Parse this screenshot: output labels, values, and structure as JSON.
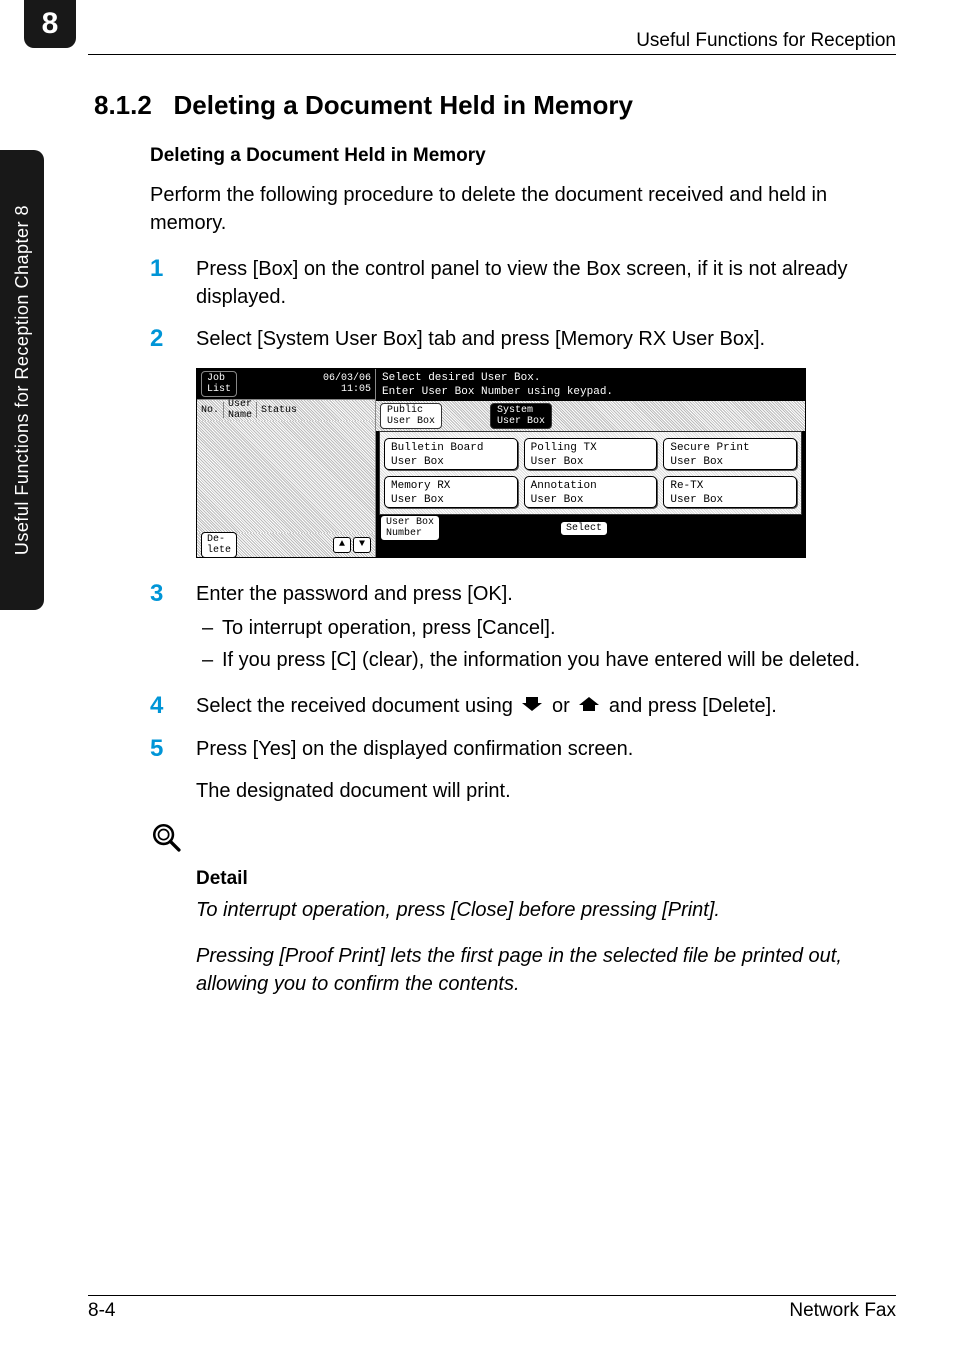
{
  "chapter": {
    "number": "8",
    "sideLabel": "Useful Functions for Reception     Chapter 8"
  },
  "headerRight": "Useful Functions for Reception",
  "section": {
    "number": "8.1.2",
    "title": "Deleting a Document Held in Memory"
  },
  "subheading": "Deleting a Document Held in Memory",
  "intro": "Perform the following procedure to delete the document received and held in memory.",
  "steps": {
    "s1": {
      "num": "1",
      "text": "Press [Box] on the control panel to view the Box screen, if it is not already displayed."
    },
    "s2": {
      "num": "2",
      "text": "Select [System User Box] tab and press [Memory RX User Box]."
    },
    "s3": {
      "num": "3",
      "text": "Enter the password and press [OK]."
    },
    "s3a": "To interrupt operation, press [Cancel].",
    "s3b": "If you press [C] (clear), the information you have entered will be deleted.",
    "s4": {
      "num": "4",
      "pre": "Select the received document using ",
      "mid": " or ",
      "post": " and press [Delete]."
    },
    "s5": {
      "num": "5",
      "text": "Press [Yes] on the displayed confirmation screen."
    }
  },
  "resultText": "The designated document will print.",
  "detail": {
    "heading": "Detail",
    "p1": "To interrupt operation, press [Close] before pressing [Print].",
    "p2": "Pressing [Proof Print] lets the first page in the selected file be printed out, allowing you to confirm the contents."
  },
  "screenshot": {
    "jobList": "Job\nList",
    "date": "06/03/06",
    "time": "11:05",
    "hdrNo": "No.",
    "hdrUser": "User\nName",
    "hdrStatus": "Status",
    "deleteBtn": "De-\nlete",
    "prompt1": "Select desired User Box.",
    "prompt2": "Enter User Box Number using keypad.",
    "tabPublic": "Public\nUser Box",
    "tabSystem": "System\nUser Box",
    "btnBulletin": "Bulletin Board\nUser Box",
    "btnPolling": "Polling TX\nUser Box",
    "btnSecure": "Secure Print\nUser Box",
    "btnMemory": "Memory RX\nUser Box",
    "btnAnnotation": "Annotation\nUser Box",
    "btnRetx": "Re-TX\nUser Box",
    "btnUserBoxNum": "User Box\nNumber",
    "btnSelect": "Select"
  },
  "footer": {
    "left": "8-4",
    "right": "Network Fax"
  }
}
